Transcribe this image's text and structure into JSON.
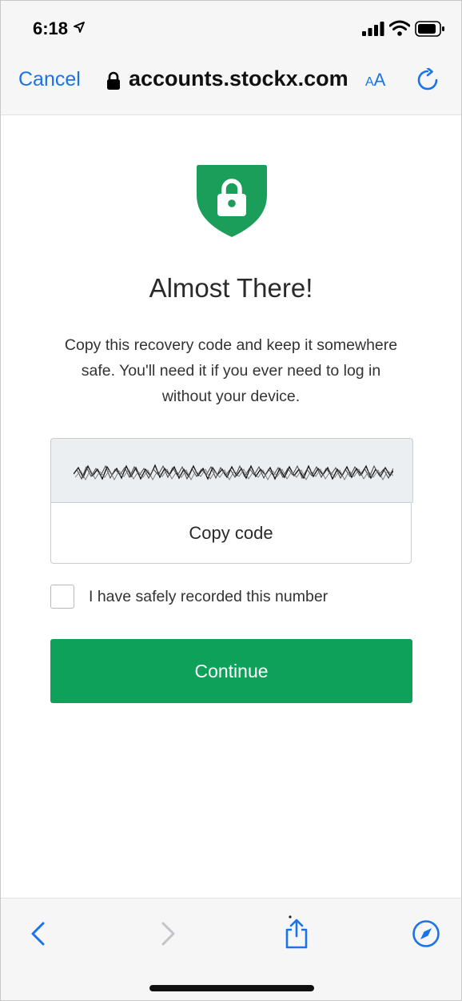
{
  "status": {
    "time": "6:18"
  },
  "browser": {
    "cancel_label": "Cancel",
    "url": "accounts.stockx.com",
    "aa_label_small": "A",
    "aa_label_large": "A"
  },
  "content": {
    "title": "Almost There!",
    "description": "Copy this recovery code and keep it somewhere safe. You'll need it if you ever need to log in without your device.",
    "copy_button_label": "Copy code",
    "checkbox_label": "I have safely recorded this number",
    "continue_label": "Continue"
  },
  "colors": {
    "accent_blue": "#1a73e8",
    "brand_green": "#0ea15a",
    "shield_green": "#1a9e5a"
  },
  "icons": [
    "location-arrow-icon",
    "signal-icon",
    "wifi-icon",
    "battery-icon",
    "lock-icon",
    "reload-icon",
    "shield-lock-icon",
    "back-icon",
    "forward-icon",
    "share-icon",
    "compass-icon"
  ]
}
